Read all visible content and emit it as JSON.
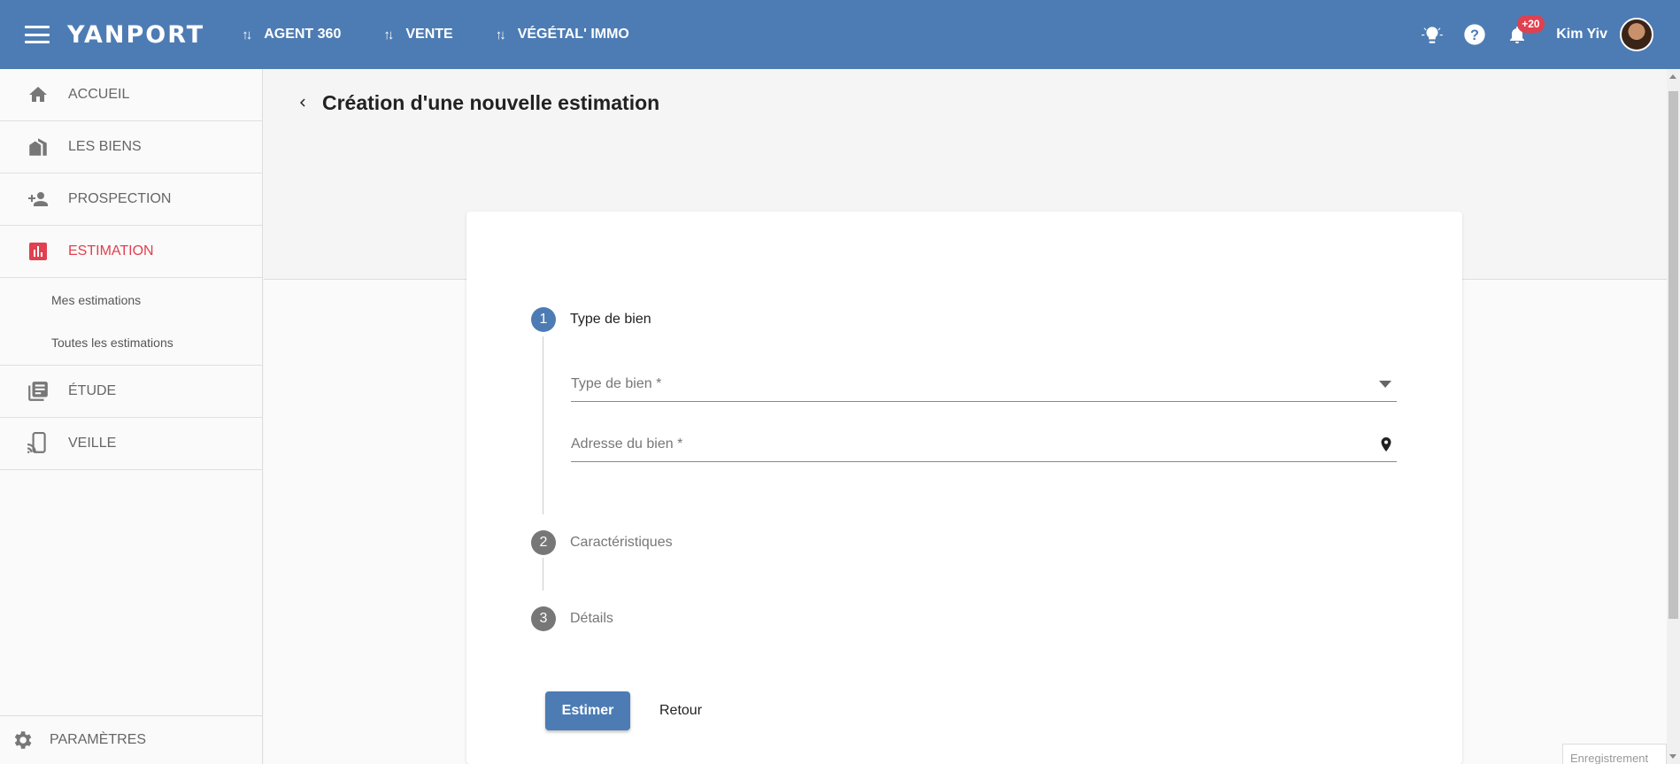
{
  "app": {
    "logo": "YANPORT",
    "nav": [
      {
        "label": "AGENT 360"
      },
      {
        "label": "VENTE"
      },
      {
        "label": "VÉGÉTAL' IMMO"
      }
    ],
    "notifications_badge": "+20",
    "user_name": "Kim Yiv",
    "colors": {
      "primary": "#4d7cb4",
      "accent": "#e0404f"
    }
  },
  "sidebar": {
    "items": [
      {
        "label": "ACCUEIL",
        "icon": "home-icon"
      },
      {
        "label": "LES BIENS",
        "icon": "buildings-icon"
      },
      {
        "label": "PROSPECTION",
        "icon": "person-add-icon"
      },
      {
        "label": "ESTIMATION",
        "icon": "bar-chart-icon",
        "active": true
      },
      {
        "label": "ÉTUDE",
        "icon": "library-icon"
      },
      {
        "label": "VEILLE",
        "icon": "device-cast-icon"
      }
    ],
    "sub_items": [
      {
        "label": "Mes estimations"
      },
      {
        "label": "Toutes les estimations"
      }
    ],
    "footer": {
      "label": "PARAMÈTRES",
      "icon": "gear-icon"
    }
  },
  "page": {
    "title": "Création d'une nouvelle estimation"
  },
  "stepper": {
    "steps": [
      {
        "num": "1",
        "label": "Type de bien",
        "active": true
      },
      {
        "num": "2",
        "label": "Caractéristiques"
      },
      {
        "num": "3",
        "label": "Détails"
      }
    ],
    "fields": {
      "property_type": "Type de bien *",
      "address": "Adresse du bien *"
    }
  },
  "actions": {
    "submit": "Estimer",
    "back": "Retour"
  },
  "save_chip": "Enregistrement"
}
